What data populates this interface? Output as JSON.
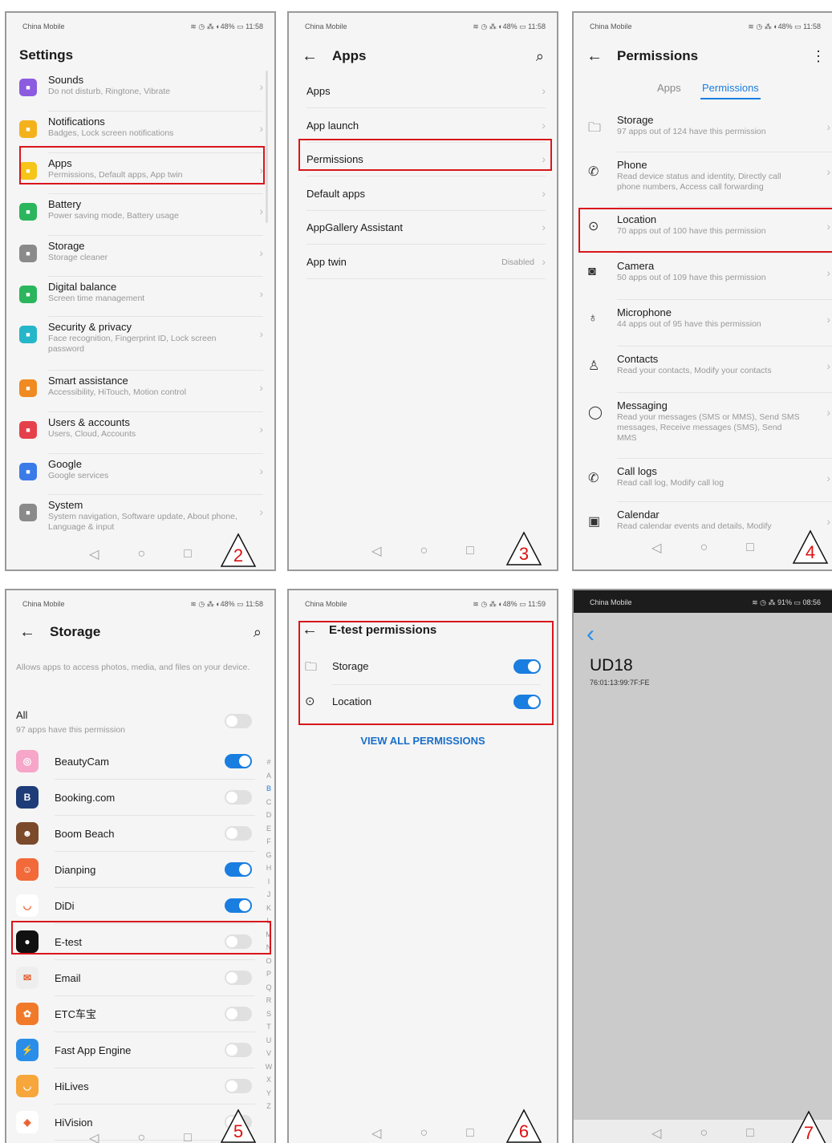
{
  "status": {
    "carrier": "China Mobile",
    "icons_p2": "≋ ◷ ⁂ ◐48% ▭ 11:58",
    "icons_p6": "≋ ◷ ⁂ ◐48% ▭ 11:59",
    "icons_p7": "≋ ◷ ⁂ 91% ▭ 08:56"
  },
  "p2": {
    "title": "Settings",
    "step": "2",
    "items": [
      {
        "title": "Sounds",
        "sub": "Do not disturb, Ringtone, Vibrate",
        "color": "#8c5be0",
        "icon": "sound-icon"
      },
      {
        "title": "Notifications",
        "sub": "Badges, Lock screen notifications",
        "color": "#f3b21c",
        "icon": "bell-icon"
      },
      {
        "title": "Apps",
        "sub": "Permissions, Default apps, App twin",
        "color": "#f5c518",
        "icon": "apps-icon"
      },
      {
        "title": "Battery",
        "sub": "Power saving mode, Battery usage",
        "color": "#2bb55c",
        "icon": "battery-icon"
      },
      {
        "title": "Storage",
        "sub": "Storage cleaner",
        "color": "#8a8a8a",
        "icon": "storage-icon"
      },
      {
        "title": "Digital balance",
        "sub": "Screen time management",
        "color": "#2bb55c",
        "icon": "hourglass-icon"
      },
      {
        "title": "Security & privacy",
        "sub": "Face recognition, Fingerprint ID, Lock screen password",
        "color": "#25b6c9",
        "icon": "shield-icon"
      },
      {
        "title": "Smart assistance",
        "sub": "Accessibility, HiTouch, Motion control",
        "color": "#f08a22",
        "icon": "hand-icon"
      },
      {
        "title": "Users & accounts",
        "sub": "Users, Cloud, Accounts",
        "color": "#e5414a",
        "icon": "user-icon"
      },
      {
        "title": "Google",
        "sub": "Google services",
        "color": "#3b7be8",
        "icon": "google-icon"
      },
      {
        "title": "System",
        "sub": "System navigation, Software update, About phone, Language & input",
        "color": "#8a8a8a",
        "icon": "system-icon"
      }
    ]
  },
  "p3": {
    "title": "Apps",
    "step": "3",
    "items": [
      {
        "title": "Apps",
        "value": ""
      },
      {
        "title": "App launch",
        "value": ""
      },
      {
        "title": "Permissions",
        "value": ""
      },
      {
        "title": "Default apps",
        "value": ""
      },
      {
        "title": "AppGallery Assistant",
        "value": ""
      },
      {
        "title": "App twin",
        "value": "Disabled"
      }
    ]
  },
  "p4": {
    "title": "Permissions",
    "tab_apps": "Apps",
    "tab_permissions": "Permissions",
    "step": "4",
    "items": [
      {
        "title": "Storage",
        "sub": "97 apps out of 124 have this permission",
        "icon": "folder-icon",
        "glyph": "🗀"
      },
      {
        "title": "Phone",
        "sub": "Read device status and identity, Directly call phone numbers, Access call forwarding",
        "icon": "phone-icon",
        "glyph": "✆"
      },
      {
        "title": "Location",
        "sub": "70 apps out of 100 have this permission",
        "icon": "location-icon",
        "glyph": "⊙"
      },
      {
        "title": "Camera",
        "sub": "50 apps out of 109 have this permission",
        "icon": "camera-icon",
        "glyph": "◙"
      },
      {
        "title": "Microphone",
        "sub": "44 apps out of 95 have this permission",
        "icon": "microphone-icon",
        "glyph": "♁"
      },
      {
        "title": "Contacts",
        "sub": "Read your contacts, Modify your contacts",
        "icon": "contact-icon",
        "glyph": "♙"
      },
      {
        "title": "Messaging",
        "sub": "Read your messages (SMS or MMS), Send SMS messages, Receive messages (SMS), Send MMS",
        "icon": "message-icon",
        "glyph": "◯"
      },
      {
        "title": "Call logs",
        "sub": "Read call log, Modify call log",
        "icon": "call-log-icon",
        "glyph": "✆"
      },
      {
        "title": "Calendar",
        "sub": "Read calendar events and details, Modify",
        "icon": "calendar-icon",
        "glyph": "▣"
      }
    ]
  },
  "p5": {
    "title": "Storage",
    "desc": "Allows apps to access photos, media, and files on your device.",
    "all_label": "All",
    "all_sub": "97 apps have this permission",
    "step": "5",
    "index": [
      "#",
      "A",
      "B",
      "C",
      "D",
      "E",
      "F",
      "G",
      "H",
      "I",
      "J",
      "K",
      "L",
      "M",
      "N",
      "O",
      "P",
      "Q",
      "R",
      "S",
      "T",
      "U",
      "V",
      "W",
      "X",
      "Y",
      "Z"
    ],
    "apps": [
      {
        "name": "BeautyCam",
        "on": true,
        "color": "#f6a6c8",
        "glyph": "◎"
      },
      {
        "name": "Booking.com",
        "on": false,
        "color": "#1d3c78",
        "glyph": "B"
      },
      {
        "name": "Boom Beach",
        "on": false,
        "color": "#7a4a2a",
        "glyph": "☻"
      },
      {
        "name": "Dianping",
        "on": true,
        "color": "#f26a3a",
        "glyph": "☺"
      },
      {
        "name": "DiDi",
        "on": true,
        "color": "#fff",
        "glyph": "◡"
      },
      {
        "name": "E-test",
        "on": false,
        "color": "#111",
        "glyph": "●"
      },
      {
        "name": "Email",
        "on": false,
        "color": "#eee",
        "glyph": "✉"
      },
      {
        "name": "ETC车宝",
        "on": false,
        "color": "#f07a2a",
        "glyph": "✿"
      },
      {
        "name": "Fast App Engine",
        "on": false,
        "color": "#2a8ee8",
        "glyph": "⚡"
      },
      {
        "name": "HiLives",
        "on": false,
        "color": "#f6a63a",
        "glyph": "◡"
      },
      {
        "name": "HiVision",
        "on": false,
        "color": "#fff",
        "glyph": "◈"
      }
    ]
  },
  "p6": {
    "title": "E-test permissions",
    "items": [
      {
        "title": "Storage",
        "on": true,
        "icon": "folder-icon",
        "glyph": "🗀"
      },
      {
        "title": "Location",
        "on": true,
        "icon": "location-icon",
        "glyph": "⊙"
      }
    ],
    "view_all": "VIEW ALL PERMISSIONS",
    "step": "6"
  },
  "p7": {
    "device": "UD18",
    "mac": "76:01:13:99:7F:FE",
    "step": "7"
  }
}
